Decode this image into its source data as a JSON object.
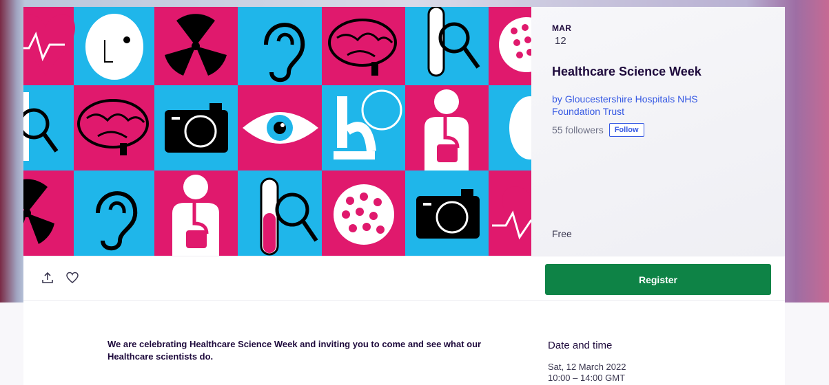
{
  "event": {
    "month": "MAR",
    "day": "12",
    "title": "Healthcare Science Week",
    "organizer_prefix": "by ",
    "organizer_name": "Gloucestershire Hospitals NHS Foundation Trust",
    "followers": "55 followers",
    "follow_label": "Follow",
    "price": "Free"
  },
  "actions": {
    "register_label": "Register",
    "share_icon": "share-icon",
    "like_icon": "heart-icon"
  },
  "details": {
    "description": "We are celebrating Healthcare Science Week and inviting you to come and see what our Healthcare scientists do.",
    "date_time_heading": "Date and time",
    "date_line": "Sat, 12 March 2022",
    "time_line": "10:00 – 14:00 GMT"
  },
  "colors": {
    "pink": "#e0196d",
    "cyan": "#1fb6ea",
    "register_green": "#0e8346",
    "link_blue": "#3659e3"
  }
}
